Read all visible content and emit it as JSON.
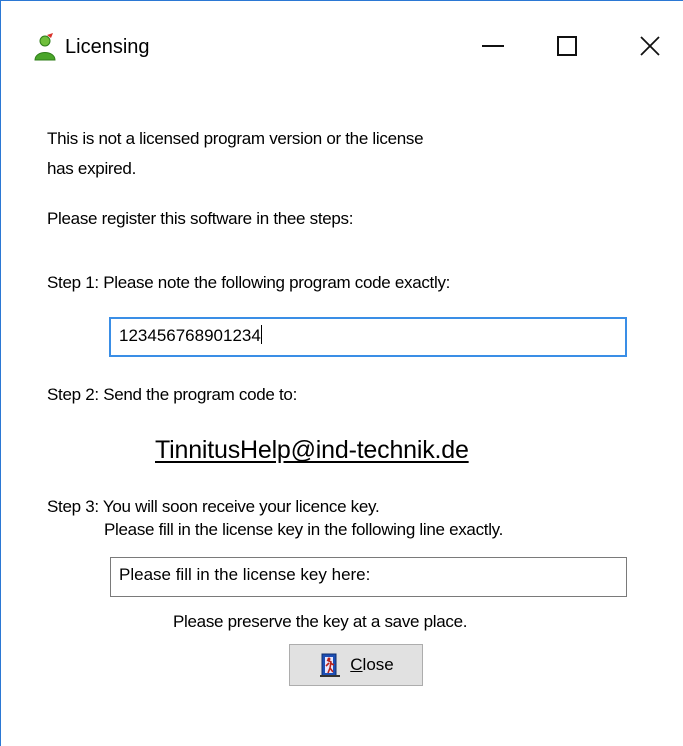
{
  "window": {
    "title": "Licensing",
    "icons": {
      "app": "user-green-icon",
      "minimize": "minimize-icon",
      "maximize": "maximize-icon",
      "close": "close-x-icon"
    },
    "accent_color": "#2b78d4"
  },
  "intro": {
    "line1": "This is not a licensed program version or the license",
    "line2": "has expired.",
    "line3": "Please register this software in thee steps:"
  },
  "step1": {
    "label": "Step 1: Please note the following program code exactly:",
    "program_code": "123456768901234"
  },
  "step2": {
    "label": "Step 2: Send the program code to:",
    "email": "TinnitusHelp@ind-technik.de"
  },
  "step3": {
    "line1": "Step 3: You will soon receive your licence key.",
    "line2": "Please fill in the license key in the following line exactly.",
    "license_field_value": "Please fill in the license key here:",
    "preserve_note": "Please preserve the key at a save place."
  },
  "buttons": {
    "close_mnemonic": "C",
    "close_rest": "lose",
    "close_icon": "door-exit-icon"
  }
}
